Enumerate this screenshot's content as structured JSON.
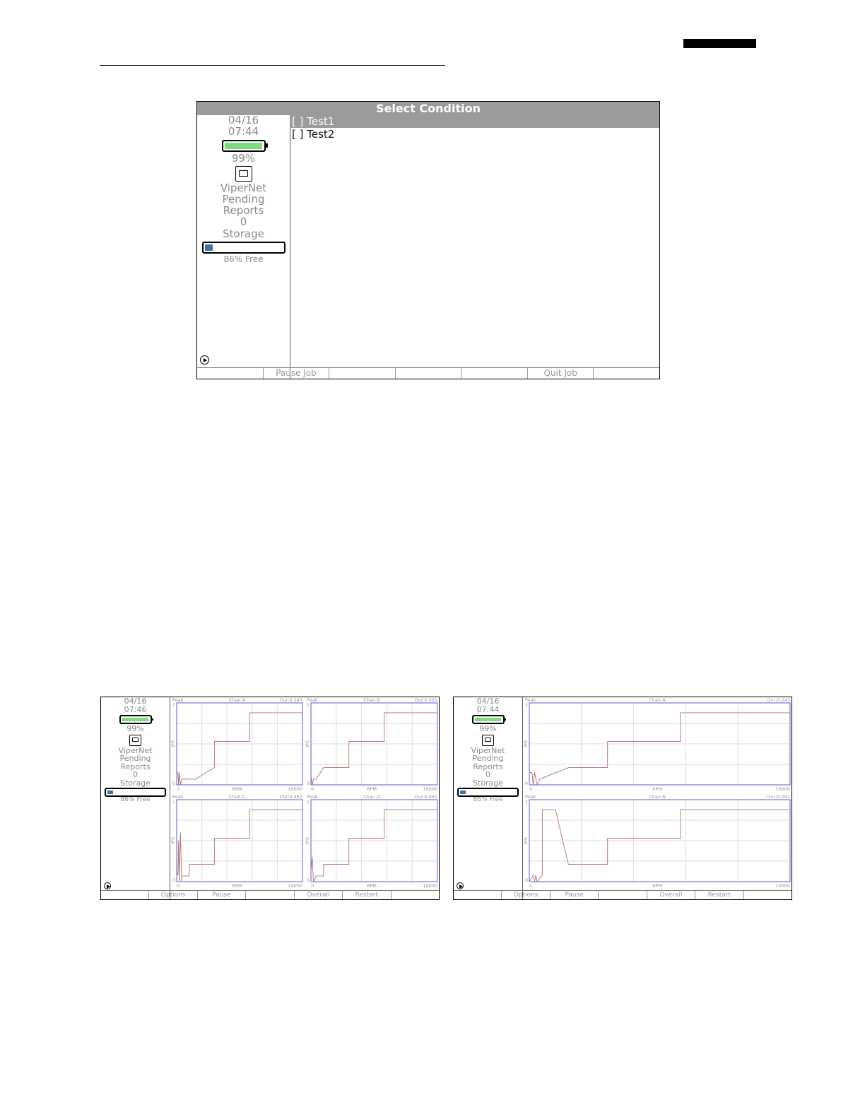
{
  "colors": {
    "battery": "#7ddc7d",
    "storage": "#3e72a8",
    "title_bar": "#9b9b9b",
    "plot_frame": "#5a5ad6",
    "plot_trace": "#b07070"
  },
  "screens": [
    {
      "title": "Select Condition",
      "sidebar": {
        "date": "04/16",
        "time": "07:44",
        "battery_pct_label": "99%",
        "battery_level": 0.99,
        "network_icon": "ethernet-icon",
        "net_label_1": "ViperNet",
        "net_label_2": "Pending",
        "net_label_3": "Reports",
        "pending_count": "0",
        "storage_label": "Storage",
        "storage_used": 0.14,
        "storage_free_label": "86% Free"
      },
      "conditions": [
        {
          "label": "[ ] Test1",
          "selected": true
        },
        {
          "label": "[ ] Test2",
          "selected": false
        }
      ],
      "softkeys": [
        "",
        "Pause Job",
        "",
        "",
        "",
        "Quit Job",
        ""
      ]
    },
    {
      "sidebar": {
        "date": "04/16",
        "time": "07:46",
        "battery_pct_label": "99%",
        "battery_level": 0.99,
        "network_icon": "ethernet-icon",
        "net_label_1": "ViperNet",
        "net_label_2": "Pending",
        "net_label_3": "Reports",
        "pending_count": "0",
        "storage_label": "Storage",
        "storage_used": 0.14,
        "storage_free_label": "86% Free"
      },
      "softkeys": [
        "",
        "Options",
        "Pause",
        "",
        "Overall",
        "Restart",
        ""
      ]
    },
    {
      "sidebar": {
        "date": "04/16",
        "time": "07:44",
        "battery_pct_label": "99%",
        "battery_level": 0.99,
        "network_icon": "ethernet-icon",
        "net_label_1": "ViperNet",
        "net_label_2": "Pending",
        "net_label_3": "Reports",
        "pending_count": "0",
        "storage_label": "Storage",
        "storage_used": 0.14,
        "storage_free_label": "86% Free"
      },
      "softkeys": [
        "",
        "Options",
        "Pause",
        "",
        "Overall",
        "Restart",
        ""
      ]
    }
  ],
  "chart_data": [
    {
      "type": "line",
      "screen": 2,
      "mode": "Peak",
      "channel": "Chan A",
      "ovr": "Ovr:0.243",
      "xlabel": "RPM",
      "ylabel": "IPS",
      "xlim": [
        0,
        10000
      ],
      "ylim": [
        0,
        1
      ],
      "xtick_labels": [
        "0",
        "10000"
      ],
      "ytick_labels": [
        "0",
        "1"
      ],
      "x": [
        0,
        100,
        150,
        200,
        300,
        400,
        1500,
        3000,
        3000,
        5800,
        5800,
        10000
      ],
      "y": [
        0.15,
        0.15,
        0.0,
        0.15,
        0.0,
        0.07,
        0.07,
        0.21,
        0.53,
        0.53,
        0.88,
        0.88
      ]
    },
    {
      "type": "line",
      "screen": 2,
      "mode": "Peak",
      "channel": "Chan B",
      "ovr": "Ovr:0.091",
      "xlabel": "RPM",
      "ylabel": "IPS",
      "xlim": [
        0,
        10000
      ],
      "ylim": [
        0,
        1
      ],
      "xtick_labels": [
        "0",
        "10000"
      ],
      "ytick_labels": [
        "0",
        "1"
      ],
      "x": [
        0,
        100,
        200,
        400,
        1000,
        3000,
        3000,
        5800,
        5800,
        10000
      ],
      "y": [
        0.12,
        0.0,
        0.07,
        0.07,
        0.21,
        0.21,
        0.53,
        0.53,
        0.88,
        0.88
      ]
    },
    {
      "type": "line",
      "screen": 2,
      "mode": "Peak",
      "channel": "Chan C",
      "ovr": "Ovr:0.452",
      "xlabel": "RPM",
      "ylabel": "IPS",
      "xlim": [
        0,
        10000
      ],
      "ylim": [
        0,
        1
      ],
      "xtick_labels": [
        "0",
        "10000"
      ],
      "ytick_labels": [
        "0",
        "1"
      ],
      "x": [
        0,
        100,
        150,
        200,
        300,
        400,
        400,
        1000,
        1000,
        3000,
        3000,
        5800,
        5800,
        10000
      ],
      "y": [
        0.12,
        0.08,
        0.5,
        0.0,
        0.6,
        0.0,
        0.07,
        0.07,
        0.21,
        0.21,
        0.53,
        0.53,
        0.88,
        0.88
      ]
    },
    {
      "type": "line",
      "screen": 2,
      "mode": "Peak",
      "channel": "Chan D",
      "ovr": "Ovr:0.091",
      "xlabel": "RPM",
      "ylabel": "IPS",
      "xlim": [
        0,
        10000
      ],
      "ylim": [
        0,
        1
      ],
      "xtick_labels": [
        "0",
        "10000"
      ],
      "ytick_labels": [
        "0",
        "1"
      ],
      "x": [
        0,
        100,
        200,
        400,
        400,
        1000,
        1000,
        3000,
        3000,
        5800,
        5800,
        10000
      ],
      "y": [
        0.12,
        0.3,
        0.0,
        0.07,
        0.07,
        0.07,
        0.21,
        0.21,
        0.53,
        0.53,
        0.88,
        0.88
      ]
    },
    {
      "type": "line",
      "screen": 3,
      "mode": "Peak",
      "channel": "Chan A",
      "ovr": "Ovr:0.243",
      "xlabel": "RPM",
      "ylabel": "IPS",
      "xlim": [
        0,
        10000
      ],
      "ylim": [
        0,
        1
      ],
      "xtick_labels": [
        "0",
        "10000"
      ],
      "ytick_labels": [
        "0",
        "1"
      ],
      "x": [
        0,
        100,
        150,
        200,
        300,
        400,
        400,
        1500,
        1500,
        3000,
        3000,
        5800,
        5800,
        10000
      ],
      "y": [
        0.15,
        0.15,
        0.0,
        0.15,
        0.0,
        0.07,
        0.07,
        0.21,
        0.21,
        0.21,
        0.53,
        0.53,
        0.88,
        0.88
      ]
    },
    {
      "type": "line",
      "screen": 3,
      "mode": "Peak",
      "channel": "Chan B",
      "ovr": "Ovr:0.091",
      "xlabel": "RPM",
      "ylabel": "IPS",
      "xlim": [
        0,
        10000
      ],
      "ylim": [
        0,
        1
      ],
      "xtick_labels": [
        "0",
        "10000"
      ],
      "ytick_labels": [
        "0",
        "1"
      ],
      "x": [
        0,
        150,
        200,
        250,
        300,
        500,
        500,
        1000,
        1500,
        3000,
        3000,
        5800,
        5800,
        10000
      ],
      "y": [
        0.0,
        0.08,
        0.0,
        0.08,
        0.0,
        0.08,
        0.88,
        0.88,
        0.21,
        0.21,
        0.53,
        0.53,
        0.88,
        0.88
      ]
    }
  ]
}
